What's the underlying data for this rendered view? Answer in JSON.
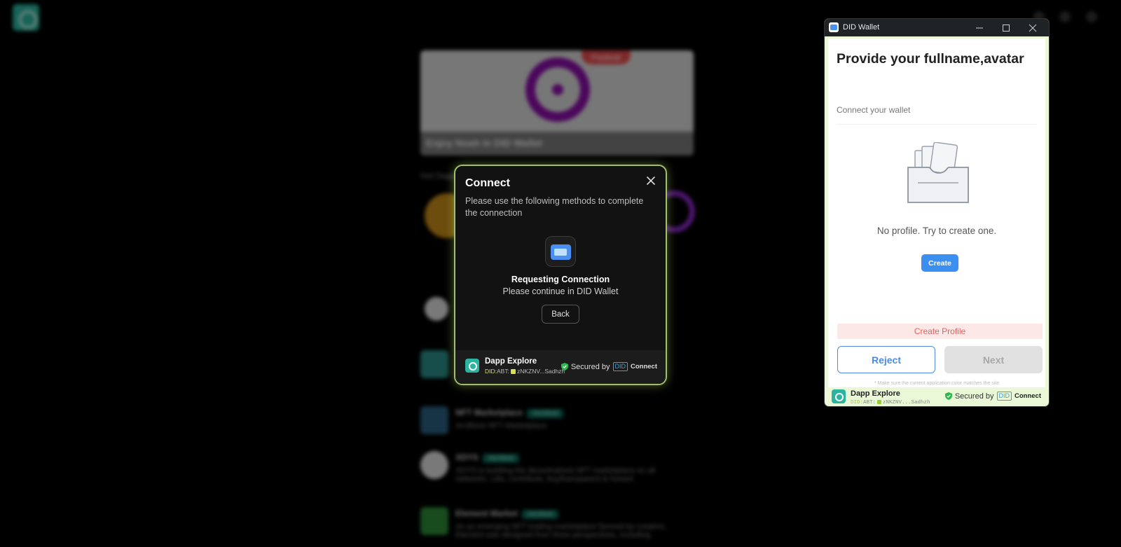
{
  "background": {
    "banner_badge": "Festival",
    "banner_caption": "Enjoy Noah in DID Wallet",
    "section_title": "Hot Dapps",
    "items": [
      {
        "title": "NFT Marketplace",
        "tag": "Verified",
        "desc": "ArcBlock NFT Marketplace"
      },
      {
        "title": "XDYS",
        "tag": "Verified",
        "desc": "XDYS is building the decentralized NFT marketplace on all networks. Like, contribute, buy/transparent & honest"
      },
      {
        "title": "Element Market",
        "tag": "Verified",
        "desc": "As an emerging NFT trading marketplace favored by creators, Element was designed from three perspectives, including"
      }
    ]
  },
  "connect_modal": {
    "title": "Connect",
    "description": "Please use the following methods to complete the connection",
    "status": "Requesting Connection",
    "substatus": "Please continue in DID Wallet",
    "back_label": "Back",
    "app_name": "Dapp Explore",
    "did_prefix": "DID:",
    "did_value": "ABT:",
    "did_address": "zNKZNV...Sadhzh",
    "secured_by": "Secured by",
    "did_badge": "DID",
    "connect_word": "Connect"
  },
  "wallet_window": {
    "window_title": "DID Wallet",
    "heading": "Provide your fullname,avatar",
    "subheading": "Connect your wallet",
    "empty_text": "No profile. Try to create one.",
    "create_label": "Create",
    "create_profile_label": "Create Profile",
    "reject_label": "Reject",
    "next_label": "Next",
    "hint": "* Make sure the current application color matches the site",
    "app_name": "Dapp Explore",
    "did_prefix": "DID:",
    "did_value": "ABT:",
    "did_address": "zNKZNV...Sadhzh",
    "secured_by": "Secured by",
    "did_badge": "DID",
    "connect_word": "Connect"
  },
  "colors": {
    "accent_blue": "#3b8ff0",
    "connect_border": "#9fbf6a",
    "secure_green": "#2db84d",
    "error_red": "#e06060"
  }
}
